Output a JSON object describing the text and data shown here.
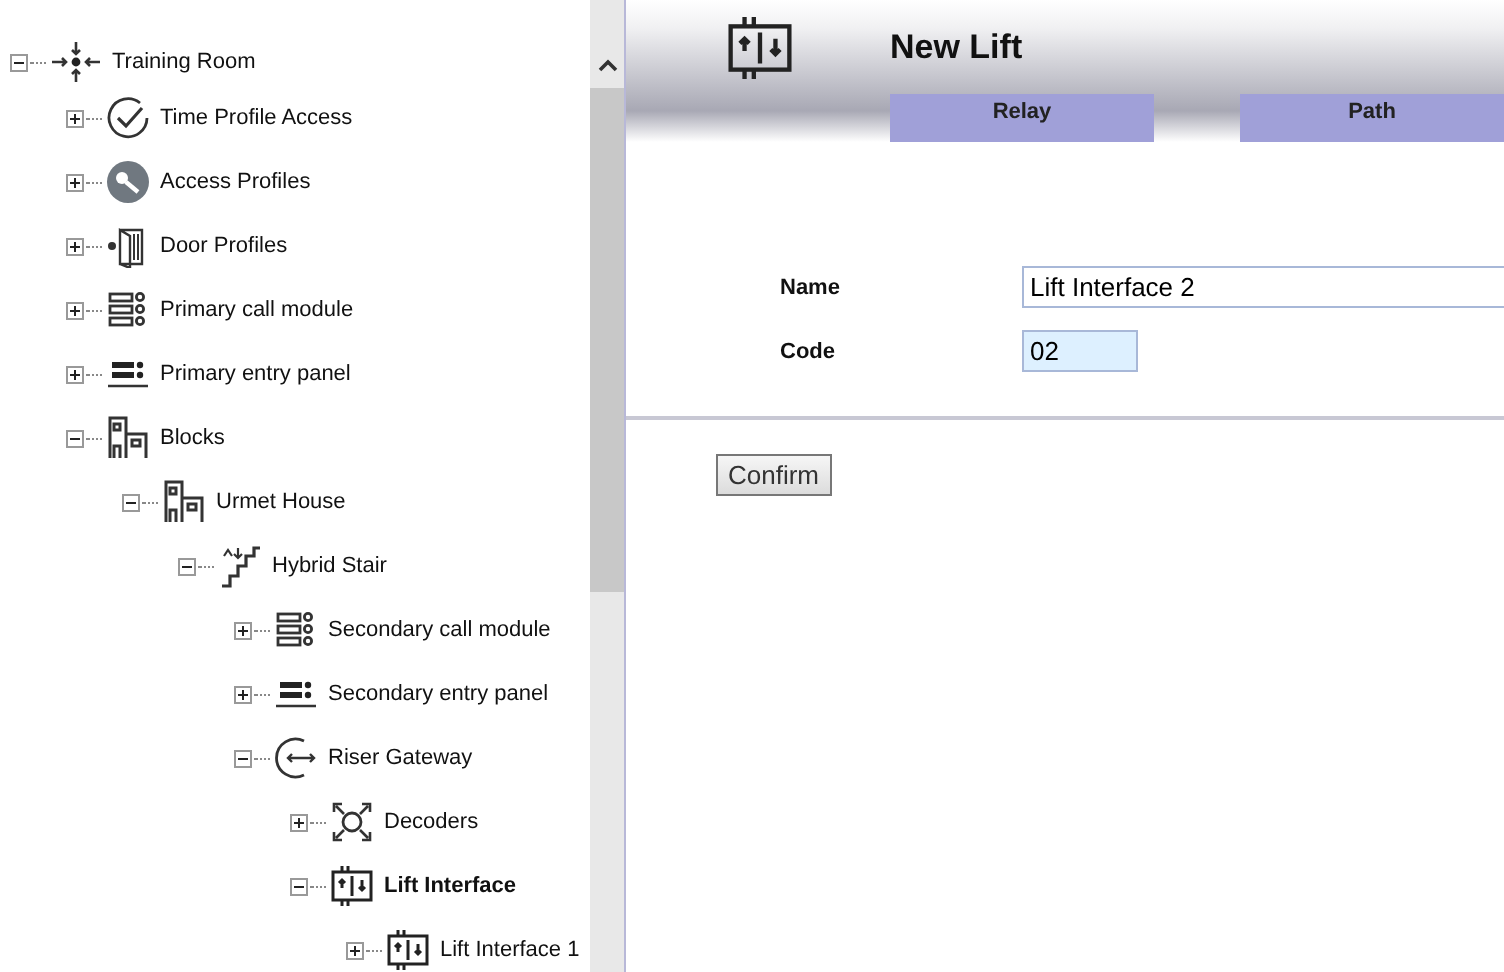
{
  "tree": [
    {
      "label": "Training Room",
      "kind": "site",
      "expanded": true,
      "selected": false,
      "children": [
        {
          "label": "Time Profile Access",
          "kind": "clock",
          "expanded": false,
          "selected": false
        },
        {
          "label": "Access Profiles",
          "kind": "key",
          "expanded": false,
          "selected": false
        },
        {
          "label": "Door Profiles",
          "kind": "door",
          "expanded": false,
          "selected": false
        },
        {
          "label": "Primary call module",
          "kind": "call-module",
          "expanded": false,
          "selected": false
        },
        {
          "label": "Primary entry panel",
          "kind": "entry-panel",
          "expanded": false,
          "selected": false
        },
        {
          "label": "Blocks",
          "kind": "building",
          "expanded": true,
          "selected": false,
          "children": [
            {
              "label": "Urmet House",
              "kind": "building",
              "expanded": true,
              "selected": false,
              "children": [
                {
                  "label": "Hybrid Stair",
                  "kind": "stair",
                  "expanded": true,
                  "selected": false,
                  "children": [
                    {
                      "label": "Secondary call module",
                      "kind": "call-module",
                      "expanded": false,
                      "selected": false
                    },
                    {
                      "label": "Secondary entry panel",
                      "kind": "entry-panel",
                      "expanded": false,
                      "selected": false
                    },
                    {
                      "label": "Riser Gateway",
                      "kind": "gateway",
                      "expanded": true,
                      "selected": false,
                      "children": [
                        {
                          "label": "Decoders",
                          "kind": "decoders",
                          "expanded": false,
                          "selected": false
                        },
                        {
                          "label": "Lift Interface",
                          "kind": "lift",
                          "expanded": true,
                          "selected": true,
                          "children": [
                            {
                              "label": "Lift Interface 1",
                              "kind": "lift",
                              "expanded": false,
                              "selected": false
                            }
                          ]
                        }
                      ]
                    }
                  ]
                }
              ]
            }
          ]
        }
      ]
    }
  ],
  "header": {
    "title": "New Lift",
    "tabs": [
      "Relay",
      "Path"
    ]
  },
  "form": {
    "fields": [
      {
        "label": "Name",
        "value": "Lift Interface 2",
        "kind": "wide"
      },
      {
        "label": "Code",
        "value": "02",
        "kind": "short"
      }
    ]
  },
  "confirm_button": "Confirm"
}
